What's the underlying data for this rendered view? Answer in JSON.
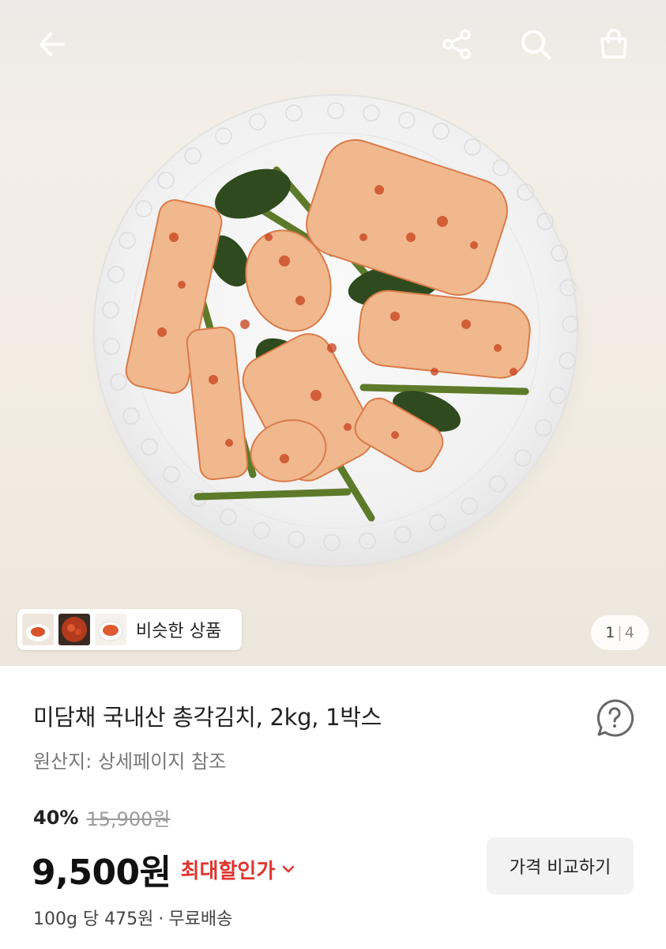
{
  "header": {
    "back_icon": "arrow-left-icon",
    "share_icon": "share-icon",
    "search_icon": "search-icon",
    "cart_icon": "shopping-bag-icon"
  },
  "gallery": {
    "similar_products_label": "비슷한 상품",
    "current_page": "1",
    "page_separator": "|",
    "total_pages": "4"
  },
  "product": {
    "title": "미담채 국내산 총각김치, 2kg, 1박스",
    "origin": "원산지: 상세페이지 참조",
    "discount_rate": "40%",
    "original_price": "15,900원",
    "sale_price": "9,500원",
    "lowest_price_label": "최대할인가",
    "compare_button_label": "가격 비교하기",
    "unit_price": "100g 당 475원",
    "shipping": "무료배송",
    "separator": "·"
  },
  "colors": {
    "accent_red": "#e0342f",
    "text_dark": "#222222",
    "text_muted": "#777777",
    "button_bg": "#f2f2f2"
  }
}
